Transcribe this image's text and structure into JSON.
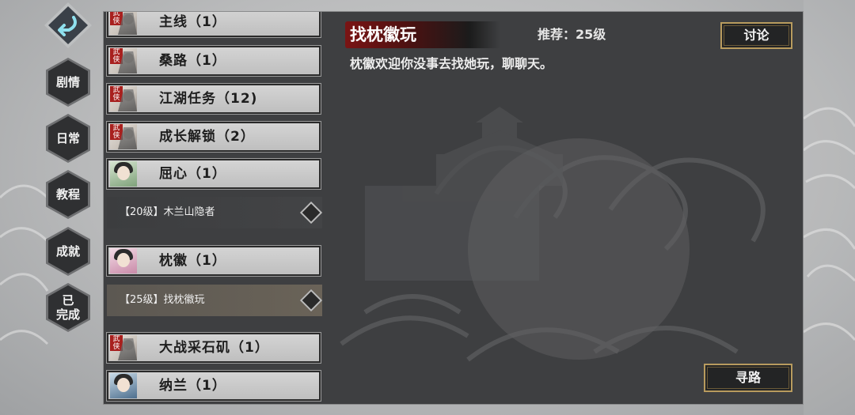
{
  "nav": {
    "back_icon": "return-arrow-icon",
    "items": [
      {
        "label": "剧情"
      },
      {
        "label": "日常"
      },
      {
        "label": "教程"
      },
      {
        "label": "成就"
      },
      {
        "label": "已\n完成"
      }
    ]
  },
  "quest_list": [
    {
      "name": "主线（1）",
      "portrait": "red-stamp"
    },
    {
      "name": "桑路（1）",
      "portrait": "red-stamp"
    },
    {
      "name": "江湖任务（12)",
      "portrait": "red-stamp"
    },
    {
      "name": "成长解锁（2）",
      "portrait": "red-stamp"
    },
    {
      "name": "屈心（1）",
      "portrait": "green-character",
      "sub": "【20级】木兰山隐者"
    },
    {
      "name": "枕徽（1）",
      "portrait": "pink-character",
      "sub": "【25级】找枕徽玩"
    },
    {
      "name": "大战采石矶（1）",
      "portrait": "red-stamp"
    },
    {
      "name": "纳兰（1）",
      "portrait": "blue-character"
    }
  ],
  "detail": {
    "title": "找枕徽玩",
    "recommend": "推荐：25级",
    "description": "枕徽欢迎你没事去找她玩，聊聊天。",
    "discuss_label": "讨论",
    "pathfind_label": "寻路"
  },
  "colors": {
    "title_bg": "#7a1414",
    "button_border": "#b89b5e",
    "panel_bg": "#3e3f41"
  }
}
